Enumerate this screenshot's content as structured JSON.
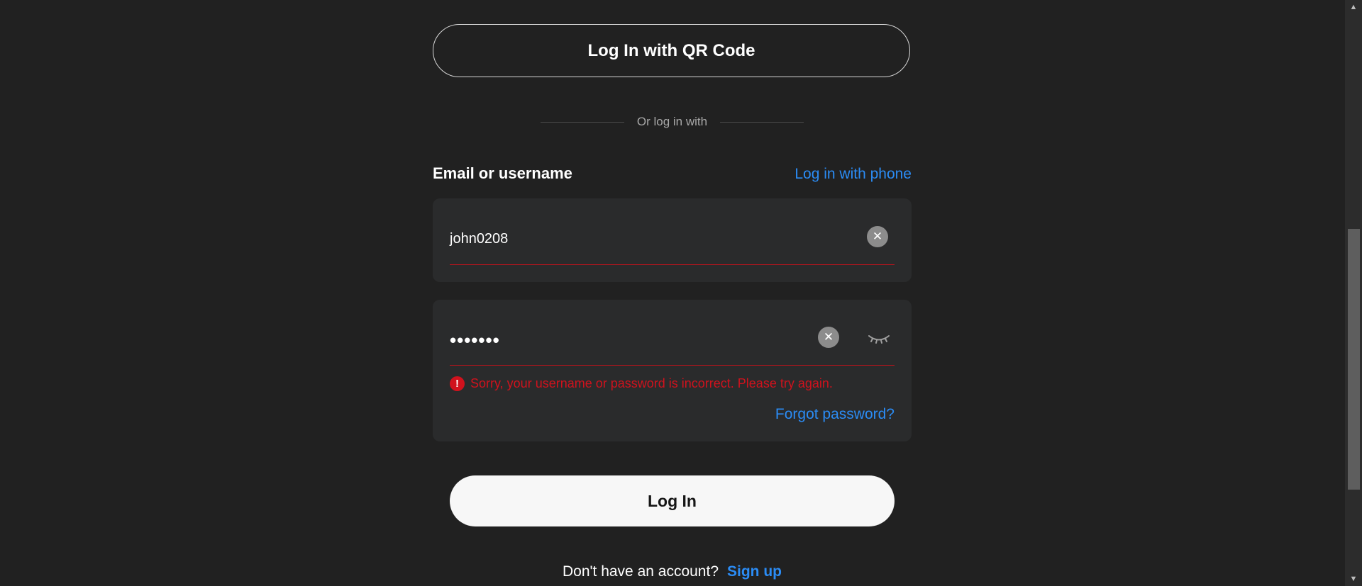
{
  "login": {
    "qr_button": "Log In with QR Code",
    "divider_text": "Or log in with",
    "email_label": "Email or username",
    "phone_link": "Log in with phone",
    "username_value": "john0208",
    "password_value": "•••••••",
    "error_message": "Sorry, your username or password is incorrect. Please try again.",
    "forgot_link": "Forgot password?",
    "login_button": "Log In",
    "signup_question": "Don't have an account?",
    "signup_link": "Sign up"
  },
  "icons": {
    "clear": "clear-icon",
    "eye": "eye-closed-icon",
    "error": "error-icon"
  },
  "colors": {
    "background": "#212121",
    "field_background": "#2a2b2c",
    "link": "#2b8cf5",
    "error": "#d0121d",
    "primary_button": "#f7f7f7"
  }
}
